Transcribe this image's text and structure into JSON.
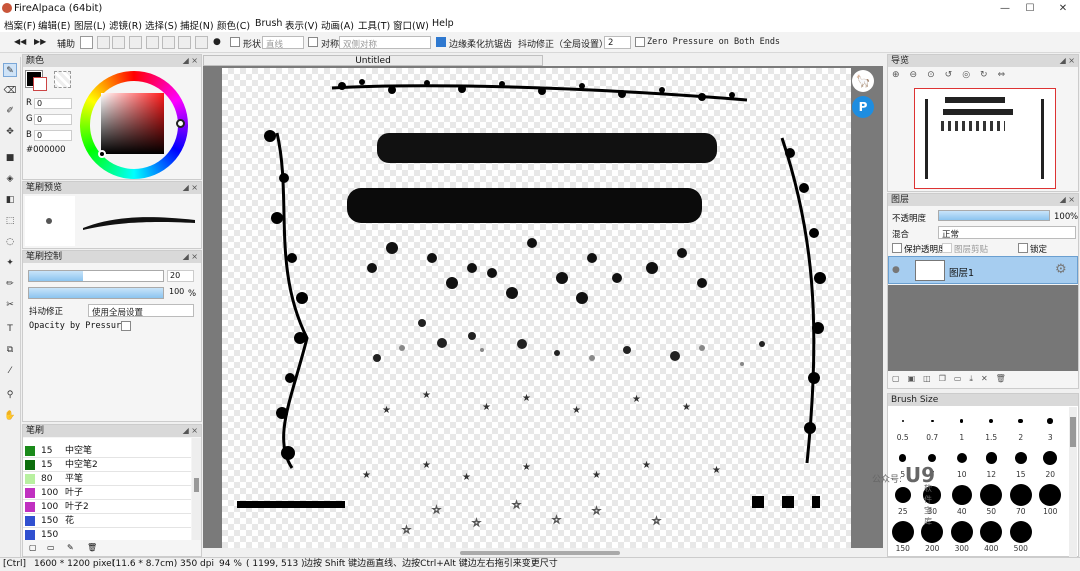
{
  "app": {
    "title": "FireAlpaca (64bit)"
  },
  "window_buttons": {
    "minimize": "—",
    "maximize": "☐",
    "close": "✕"
  },
  "menu": [
    "档案(F)",
    "编辑(E)",
    "图层(L)",
    "滤镜(R)",
    "选择(S)",
    "捕捉(N)",
    "颜色(C)",
    "Brush",
    "表示(V)",
    "动画(A)",
    "工具(T)",
    "窗口(W)",
    "Help"
  ],
  "toolbar": {
    "snap_label": "辅助",
    "shape_label": "形状",
    "shape_value": "直线",
    "symmetry_label": "对称",
    "symmetry_value": "双侧对称",
    "antialias_label": "边缘柔化抗锯齿",
    "stabilizer_label": "抖动修正（全局设置）",
    "stabilizer_value": "2",
    "zero_pressure_label": "Zero Pressure on Both Ends"
  },
  "color_panel": {
    "title": "颜色",
    "r_label": "R",
    "r": "0",
    "g_label": "G",
    "g": "0",
    "b_label": "B",
    "b": "0",
    "hex": "#000000"
  },
  "brush_preview": {
    "title": "笔刷预览"
  },
  "brush_control": {
    "title": "笔刷控制",
    "size": "20",
    "opacity": "100",
    "percent": "%",
    "stabilizer_label": "抖动修正",
    "stabilizer_value": "使用全局设置",
    "opacity_pressure_label": "Opacity by Pressure"
  },
  "brush_list": {
    "title": "笔刷",
    "items": [
      {
        "size": "15",
        "name": "中空笔",
        "color": "#1a8a1a"
      },
      {
        "size": "15",
        "name": "中空笔2",
        "color": "#0d6e0d"
      },
      {
        "size": "80",
        "name": "平笔",
        "color": "#b8f0a0"
      },
      {
        "size": "100",
        "name": "叶子",
        "color": "#c030c0"
      },
      {
        "size": "100",
        "name": "叶子2",
        "color": "#c030c0"
      },
      {
        "size": "150",
        "name": "花",
        "color": "#3050d0"
      },
      {
        "size": "150",
        "name": "",
        "color": "#3050d0"
      }
    ]
  },
  "document": {
    "tab": "Untitled"
  },
  "navigator": {
    "title": "导览"
  },
  "layers": {
    "title": "图层",
    "opacity_label": "不透明度",
    "opacity_value": "100",
    "percent": "%",
    "blend_label": "混合",
    "blend_value": "正常",
    "protect_alpha": "保护透明度",
    "clipping": "图层剪贴",
    "lock": "锁定",
    "layer_name": "图层1"
  },
  "brush_size": {
    "title": "Brush Size",
    "sizes": [
      "0.5",
      "0.7",
      "1",
      "1.5",
      "2",
      "3",
      "5",
      "7",
      "10",
      "12",
      "15",
      "20",
      "25",
      "30",
      "40",
      "50",
      "70",
      "100",
      "150",
      "200",
      "300",
      "400",
      "500"
    ]
  },
  "watermark": {
    "text": "公众号:",
    "logo": "U9",
    "sub": "软件宝库"
  },
  "status": {
    "ctrl": "[Ctrl]",
    "pixel": "1600 * 1200 pixel",
    "cm": "(11.6 * 8.7cm)",
    "dpi": "350 dpi",
    "zoom": "94 %",
    "coords": "( 1199, 513 )",
    "hint": "边按 Shift 键边画直线、边按Ctrl+Alt 键边左右拖引来变更尺寸"
  }
}
